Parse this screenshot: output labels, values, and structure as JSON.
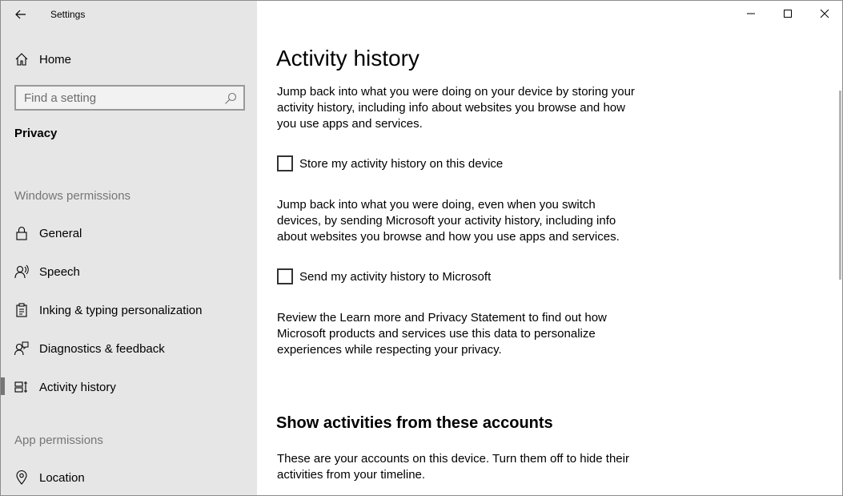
{
  "window": {
    "title": "Settings",
    "controls": {
      "minimize_icon": "minimize-icon",
      "maximize_icon": "maximize-icon",
      "close_icon": "close-icon"
    }
  },
  "sidebar": {
    "home_label": "Home",
    "search": {
      "placeholder": "Find a setting",
      "value": ""
    },
    "category": "Privacy",
    "windows_permissions_header": "Windows permissions",
    "items": [
      {
        "label": "General",
        "icon": "lock-icon"
      },
      {
        "label": "Speech",
        "icon": "speech-icon"
      },
      {
        "label": "Inking & typing personalization",
        "icon": "inking-icon"
      },
      {
        "label": "Diagnostics & feedback",
        "icon": "feedback-icon"
      },
      {
        "label": "Activity history",
        "icon": "activity-icon",
        "active": true
      }
    ],
    "app_permissions_header": "App permissions",
    "app_items": [
      {
        "label": "Location",
        "icon": "location-icon"
      }
    ]
  },
  "main": {
    "title": "Activity history",
    "intro": "Jump back into what you were doing on your device by storing your activity history, including info about websites you browse and how you use apps and services.",
    "store_checkbox": {
      "label": "Store my activity history on this device",
      "checked": false
    },
    "send_intro": "Jump back into what you were doing, even when you switch devices, by sending Microsoft your activity history, including info about websites you browse and how you use apps and services.",
    "send_checkbox": {
      "label": "Send my activity history to Microsoft",
      "checked": false
    },
    "review_text": "Review the Learn more and Privacy Statement to find out how Microsoft products and services use this data to personalize experiences while respecting your privacy.",
    "accounts_title": "Show activities from these accounts",
    "accounts_text": "These are your accounts on this device. Turn them off to hide their activities from your timeline."
  },
  "colors": {
    "sidebar_bg": "#e6e6e6",
    "content_bg": "#ffffff",
    "section_header": "#767676",
    "active_bar": "#767676"
  }
}
